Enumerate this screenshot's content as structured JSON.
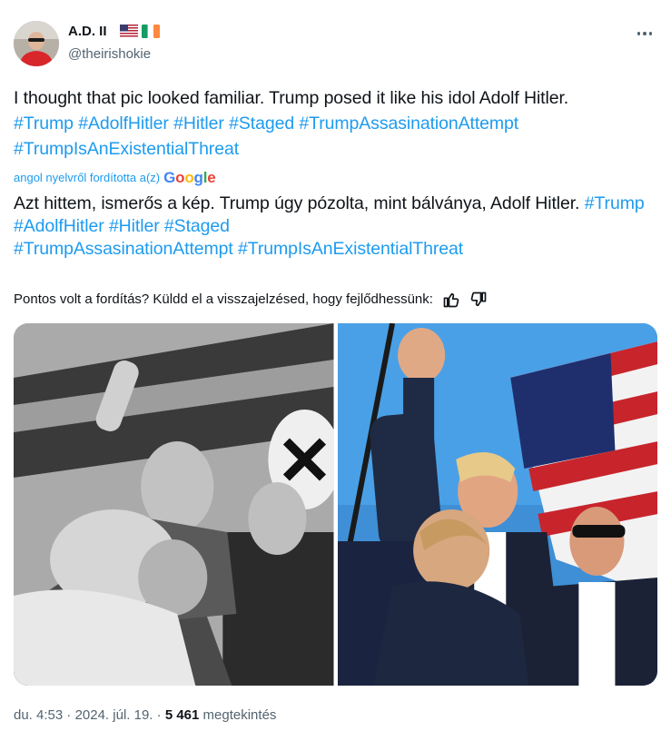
{
  "author": {
    "name": "A.D. II",
    "handle": "@theirishokie",
    "flags": [
      "us-flag-icon",
      "ireland-flag-icon"
    ]
  },
  "tweet": {
    "text": "I thought that pic looked familiar. Trump posed it like his idol Adolf Hitler.",
    "hashtags": [
      "#Trump",
      "#AdolfHitler",
      "#Hitler",
      "#Staged",
      "#TrumpAssasinationAttempt",
      "#TrumpIsAnExistentialThreat"
    ]
  },
  "translation": {
    "label": "angol nyelvről fordította a(z)",
    "provider": "Google",
    "text": "Azt hittem, ismerős a kép. Trump úgy pózolta, mint bálványa, Adolf Hitler.",
    "hashtags": [
      "#Trump",
      "#AdolfHitler",
      "#Hitler",
      "#Staged",
      "#TrumpAssasinationAttempt",
      "#TrumpIsAnExistentialThreat"
    ]
  },
  "feedback": {
    "question": "Pontos volt a fordítás? Küldd el a visszajelzésed, hogy fejlődhessünk:",
    "icons": [
      "thumbs-up-icon",
      "thumbs-down-icon"
    ]
  },
  "media": [
    {
      "name": "photo-left",
      "tone": "grayscale"
    },
    {
      "name": "photo-right",
      "tone": "color"
    }
  ],
  "meta": {
    "time": "du. 4:53",
    "sep": "·",
    "date": "2024. júl. 19.",
    "views": "5 461",
    "views_label": "megtekintés"
  },
  "colors": {
    "accent": "#1d9bf0",
    "text": "#0f1419",
    "secondary": "#536471"
  }
}
